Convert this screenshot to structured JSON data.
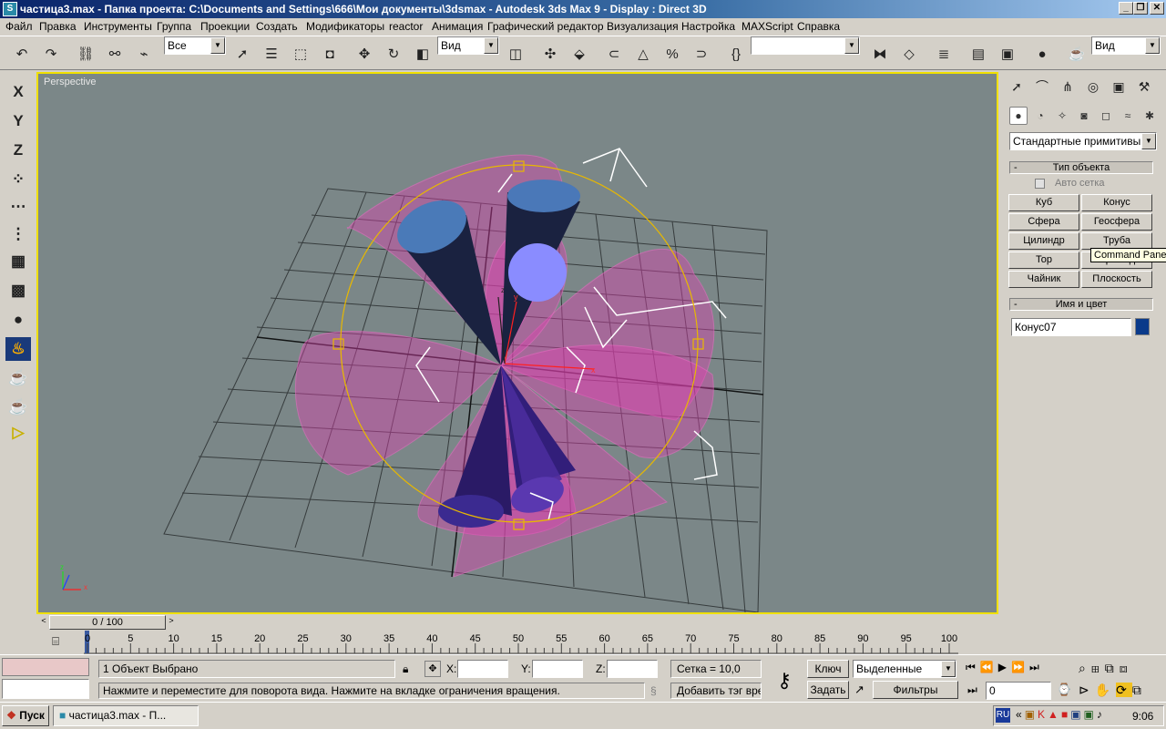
{
  "window": {
    "title": "частица3.max    - Папка проекта: C:\\Documents and Settings\\666\\Мои документы\\3dsmax     - Autodesk 3ds Max 9     - Display : Direct 3D",
    "app_icon": "3ds-max-icon",
    "controls": [
      "_",
      "❐",
      "✕"
    ]
  },
  "menu": [
    "Файл",
    "Правка",
    "Инструменты",
    "Группа",
    "Проекции",
    "Создать",
    "Модификаторы",
    "reactor",
    "Анимация",
    "Графический редактор",
    "Визуализация",
    "Настройка",
    "MAXScript",
    "Справка"
  ],
  "toolbar": {
    "selection_filter": "Все",
    "ref_coord": "Вид",
    "named_selection": "",
    "render_view": "Вид"
  },
  "left_toolbar": {
    "axis_x": "X",
    "axis_y": "Y",
    "axis_z": "Z"
  },
  "viewport": {
    "label": "Perspective",
    "axis_x": "x",
    "axis_y": "y",
    "axis_z": "z"
  },
  "command_panel": {
    "category": "Стандартные примитивы",
    "object_type_title": "Тип объекта",
    "autogrid_label": "Авто сетка",
    "buttons": [
      "Куб",
      "Конус",
      "Сфера",
      "Геосфера",
      "Цилиндр",
      "Труба",
      "Тор",
      "Пирамида",
      "Чайник",
      "Плоскость"
    ],
    "name_color_title": "Имя и цвет",
    "object_name": "Конус07",
    "object_color": "#0a3a8a",
    "tooltip": "Command Panel"
  },
  "time_slider": {
    "label": "0 / 100",
    "ticks": [
      "0",
      "5",
      "10",
      "15",
      "20",
      "25",
      "30",
      "35",
      "40",
      "45",
      "50",
      "55",
      "60",
      "65",
      "70",
      "75",
      "80",
      "85",
      "90",
      "95",
      "100"
    ]
  },
  "status": {
    "selection": "1 Объект Выбрано",
    "x_label": "X:",
    "y_label": "Y:",
    "z_label": "Z:",
    "x_value": "",
    "y_value": "",
    "z_value": "",
    "grid": "Сетка = 10,0",
    "prompt": "Нажмите и переместите для поворота вида.  Нажмите на вкладке ограничения вращения.",
    "add_time_tag": "Добавить тэг врем",
    "auto_key": "Ключ",
    "set_key": "Задать",
    "key_mode": "Выделенные",
    "key_filters": "Фильтры ключей",
    "current_frame": "0"
  },
  "taskbar": {
    "start": "Пуск",
    "task": "частица3.max    - П...",
    "lang": "RU",
    "clock": "9:06"
  }
}
